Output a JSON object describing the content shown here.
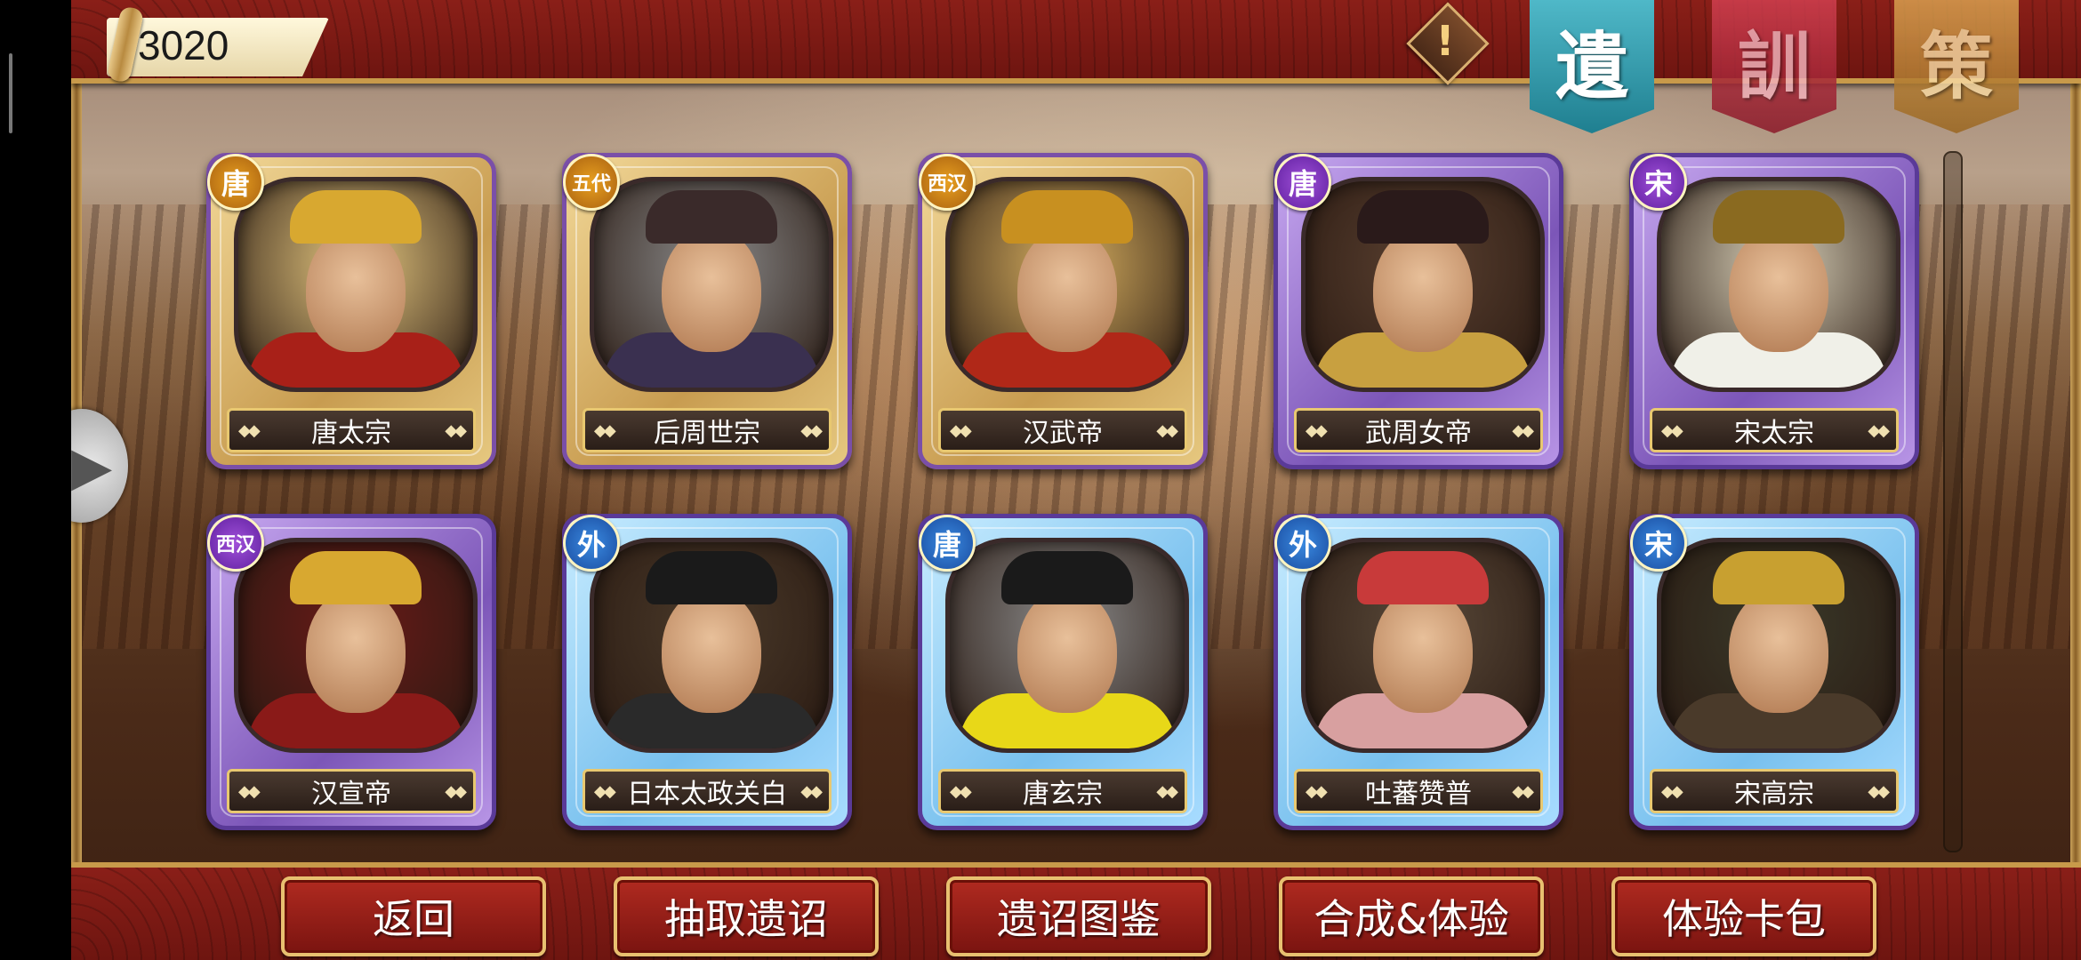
{
  "currency": {
    "value": "3020",
    "icon": "scroll-icon"
  },
  "alert": {
    "glyph": "!",
    "icon": "alert-icon"
  },
  "banners": [
    {
      "label": "遺",
      "icon": "banner-yi"
    },
    {
      "label": "訓",
      "icon": "banner-xun"
    },
    {
      "label": "策",
      "icon": "banner-ce"
    }
  ],
  "nameplate_decoration": "◆◆",
  "cards": [
    {
      "name": "唐太宗",
      "dynasty": "唐",
      "rarity": "gold",
      "badge": "gold",
      "hat": "#d8a830",
      "robe": "#a82018",
      "bg": "#e6c880"
    },
    {
      "name": "后周世宗",
      "dynasty": "五代",
      "rarity": "gold",
      "badge": "gold",
      "hat": "#3a2a2a",
      "robe": "#3a3050",
      "bg": "#8a8a8a"
    },
    {
      "name": "汉武帝",
      "dynasty": "西汉",
      "rarity": "gold",
      "badge": "gold",
      "hat": "#c89020",
      "robe": "#b02818",
      "bg": "#d8b060"
    },
    {
      "name": "武周女帝",
      "dynasty": "唐",
      "rarity": "purple",
      "badge": "purple",
      "hat": "#2a1a1a",
      "robe": "#c8a040",
      "bg": "#5a4030"
    },
    {
      "name": "宋太宗",
      "dynasty": "宋",
      "rarity": "purple",
      "badge": "purple",
      "hat": "#8a6a20",
      "robe": "#f0f0e8",
      "bg": "#d8d0b8"
    },
    {
      "name": "汉宣帝",
      "dynasty": "西汉",
      "rarity": "purple",
      "badge": "purple",
      "hat": "#d8a830",
      "robe": "#8a1a18",
      "bg": "#6a1a18"
    },
    {
      "name": "日本太政关白",
      "dynasty": "外",
      "rarity": "blue",
      "badge": "blue",
      "hat": "#1a1a1a",
      "robe": "#2a2a2a",
      "bg": "#4a3a2a"
    },
    {
      "name": "唐玄宗",
      "dynasty": "唐",
      "rarity": "blue",
      "badge": "blue",
      "hat": "#1a1a1a",
      "robe": "#e8d818",
      "bg": "#8a8a8a"
    },
    {
      "name": "吐蕃赞普",
      "dynasty": "外",
      "rarity": "blue",
      "badge": "blue",
      "hat": "#c83a3a",
      "robe": "#d8a0a0",
      "bg": "#5a4a3a"
    },
    {
      "name": "宋高宗",
      "dynasty": "宋",
      "rarity": "blue",
      "badge": "blue",
      "hat": "#c8a030",
      "robe": "#4a3a2a",
      "bg": "#3a3a2a"
    }
  ],
  "buttons": [
    {
      "label": "返回"
    },
    {
      "label": "抽取遗诏"
    },
    {
      "label": "遗诏图鉴"
    },
    {
      "label": "合成&体验"
    },
    {
      "label": "体验卡包"
    }
  ]
}
